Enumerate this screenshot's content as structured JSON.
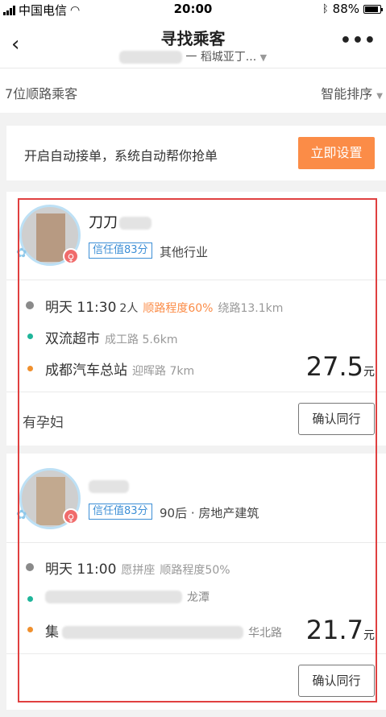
{
  "status_bar": {
    "carrier": "中国电信",
    "time": "20:00",
    "battery": "88%",
    "battery_level": 0.88
  },
  "nav": {
    "title": "寻找乘客",
    "route_to": "稻城亚丁...",
    "back_icon": "chevron-left-icon",
    "more_icon": "more-dots-icon"
  },
  "filter": {
    "count_label": "7位顺路乘客",
    "sort_label": "智能排序"
  },
  "banner": {
    "text": "开启自动接单，系统自动帮你抢单",
    "button": "立即设置"
  },
  "passengers": [
    {
      "name": "刀刀",
      "gender": "♀",
      "trust": "信任值83分",
      "industry": "其他行业",
      "time": "明天 11:30",
      "seats": "2人",
      "match": "顺路程度60%",
      "detour": "绕路13.1km",
      "from": "双流超市",
      "from_detail": "成工路 5.6km",
      "to": "成都汽车总站",
      "to_detail": "迎晖路 7km",
      "price": "27.5",
      "unit": "元",
      "note": "有孕妇",
      "confirm": "确认同行"
    },
    {
      "gender": "♀",
      "trust": "信任值83分",
      "industry": "90后 · 房地产建筑",
      "time": "明天 11:00",
      "seats": "愿拼座",
      "match": "顺路程度50%",
      "from_detail": "龙潭",
      "to": "集",
      "to_detail": "华北路",
      "price": "21.7",
      "unit": "元",
      "confirm": "确认同行"
    }
  ]
}
